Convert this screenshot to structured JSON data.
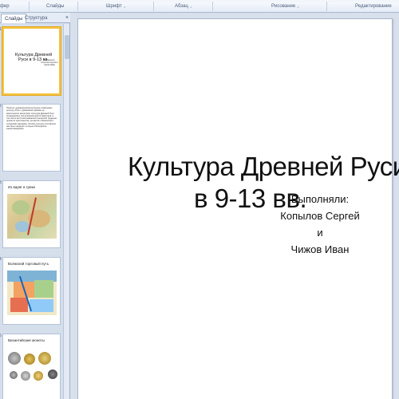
{
  "ribbon": {
    "groups": [
      "фер обмена",
      "Слайды",
      "Шрифт",
      "Абзац",
      "Рисование",
      "Редактирование"
    ]
  },
  "left_pane": {
    "tabs": [
      "Слайды",
      "Структура"
    ],
    "close_glyph": "×",
    "slides": [
      {
        "number": "1",
        "title": "Культура Древней Руси в 9-13 вв.",
        "authors": "Выполняли: Копылов Сергей и Чижов Иван"
      },
      {
        "number": "2",
        "text": "Понятие «древнерусская культура» охватывает культуру Руси с древнейших времён до монгольского нашествия. Культура Древней Руси складывалась под влиянием многих факторов, в том числе восточнославянской языческой традиции, принятия христианства, контактов с Византией и соседними народами. Основу культуры составляли местные традиции, которые обогащались заимствованиями."
      },
      {
        "number": "3",
        "title": "Из варяг в греки"
      },
      {
        "number": "4",
        "title": "Волжский торговый путь"
      },
      {
        "number": "5",
        "title": "Византийские монеты"
      }
    ]
  },
  "slide": {
    "title_line1": "Культура Древней Руси",
    "title_line2": "в 9-13 вв.",
    "authors_line1": "Выполняли:",
    "authors_line2": "Копылов Сергей",
    "authors_line3": "и",
    "authors_line4": "Чижов Иван"
  },
  "colors": {
    "selection": "#f6c342",
    "ribbon_bg": "#e3ebf6",
    "pane_bg": "#d5deeb"
  }
}
